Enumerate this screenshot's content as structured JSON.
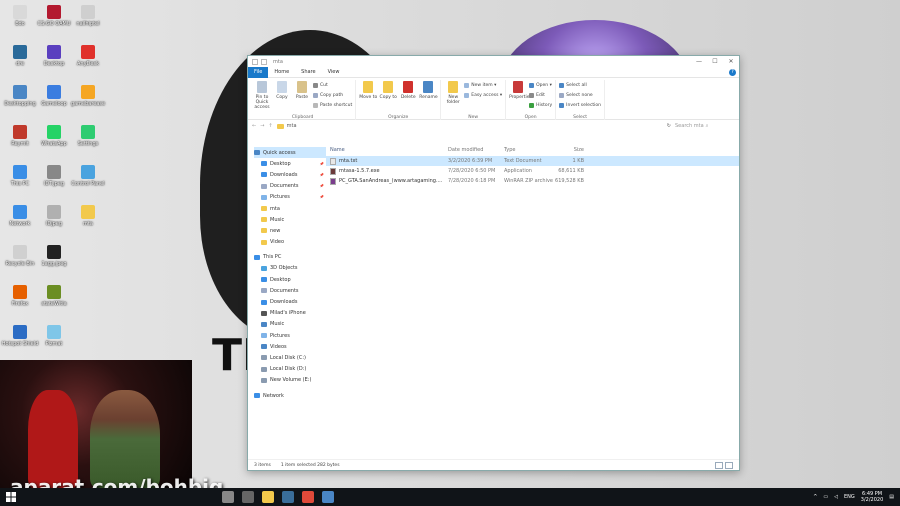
{
  "desktop": {
    "background_text": "TI",
    "icons": [
      {
        "label": "Edo",
        "color": "#d9d9d9",
        "col": 0,
        "row": 0
      },
      {
        "label": "CS:GO\nOAMU",
        "color": "#b3192f",
        "col": 1,
        "row": 0
      },
      {
        "label": "nailhiptel",
        "color": "#cfcfcf",
        "col": 2,
        "row": 0
      },
      {
        "label": "dre",
        "color": "#2a6a9a",
        "col": 0,
        "row": 1
      },
      {
        "label": "Desktop",
        "color": "#5a3fbf",
        "col": 1,
        "row": 1
      },
      {
        "label": "AnyDesk",
        "color": "#e0312b",
        "col": 2,
        "row": 1
      },
      {
        "label": "Desktopping",
        "color": "#4a86c5",
        "col": 0,
        "row": 2
      },
      {
        "label": "Gameloop",
        "color": "#3b7de0",
        "col": 1,
        "row": 2
      },
      {
        "label": "gamebarease",
        "color": "#f5a623",
        "col": 2,
        "row": 2
      },
      {
        "label": "Reymit",
        "color": "#c0392b",
        "col": 0,
        "row": 3
      },
      {
        "label": "WhatsApp",
        "color": "#25d366",
        "col": 1,
        "row": 3
      },
      {
        "label": "Settings",
        "color": "#2ecc71",
        "col": 2,
        "row": 3
      },
      {
        "label": "This PC",
        "color": "#3a8ee6",
        "col": 0,
        "row": 4
      },
      {
        "label": "IDT.jpeg",
        "color": "#888888",
        "col": 1,
        "row": 4
      },
      {
        "label": "Control Panel",
        "color": "#4aa3df",
        "col": 2,
        "row": 4
      },
      {
        "label": "Network",
        "color": "#3a8ee6",
        "col": 0,
        "row": 5
      },
      {
        "label": "IDjpeg",
        "color": "#b0b0b0",
        "col": 1,
        "row": 5
      },
      {
        "label": "mta",
        "color": "#f2c94c",
        "col": 2,
        "row": 5
      },
      {
        "label": "Recycle Bin",
        "color": "#d0d0d0",
        "col": 0,
        "row": 6
      },
      {
        "label": "1agg.jpeg",
        "color": "#222222",
        "col": 1,
        "row": 6
      },
      {
        "label": "Firefox",
        "color": "#e66000",
        "col": 0,
        "row": 7
      },
      {
        "label": "stateWitia",
        "color": "#6b8e23",
        "col": 1,
        "row": 7
      },
      {
        "label": "Hotspot Shield",
        "color": "#2b6cc4",
        "col": 0,
        "row": 8
      },
      {
        "label": "Pizmat",
        "color": "#7fc6e8",
        "col": 1,
        "row": 8
      }
    ]
  },
  "watermark": "aparat.com/bohbig",
  "explorer": {
    "title": "mta",
    "window_controls": {
      "minimize": "—",
      "maximize": "☐",
      "close": "✕"
    },
    "tabs": [
      {
        "label": "File",
        "active": true
      },
      {
        "label": "Home",
        "active": false
      },
      {
        "label": "Share",
        "active": false
      },
      {
        "label": "View",
        "active": false
      }
    ],
    "help": "?",
    "ribbon": {
      "clipboard": {
        "name": "Clipboard",
        "big": [
          {
            "label": "Pin to Quick access",
            "icon": "pin-icon",
            "color": "#b8c7d9"
          },
          {
            "label": "Copy",
            "icon": "copy-icon",
            "color": "#c9d7e8"
          },
          {
            "label": "Paste",
            "icon": "paste-icon",
            "color": "#d9c28a"
          }
        ],
        "small": [
          {
            "label": "Cut",
            "icon": "scissors-icon",
            "color": "#888888"
          },
          {
            "label": "Copy path",
            "icon": "copy-path-icon",
            "color": "#9aa8c4"
          },
          {
            "label": "Paste shortcut",
            "icon": "paste-shortcut-icon",
            "color": "#b8b8b8"
          }
        ]
      },
      "organize": {
        "name": "Organize",
        "big": [
          {
            "label": "Move to",
            "icon": "move-to-icon",
            "color": "#f2c94c"
          },
          {
            "label": "Copy to",
            "icon": "copy-to-icon",
            "color": "#f2c94c"
          },
          {
            "label": "Delete",
            "icon": "delete-icon",
            "color": "#d0312d"
          },
          {
            "label": "Rename",
            "icon": "rename-icon",
            "color": "#4a86c5"
          }
        ]
      },
      "new": {
        "name": "New",
        "big": [
          {
            "label": "New folder",
            "icon": "new-folder-icon",
            "color": "#f2c94c"
          }
        ],
        "small": [
          {
            "label": "New item ▾",
            "icon": "new-item-icon",
            "color": "#9ab8dd"
          },
          {
            "label": "Easy access ▾",
            "icon": "easy-access-icon",
            "color": "#9ab8dd"
          }
        ]
      },
      "open": {
        "name": "Open",
        "big": [
          {
            "label": "Properties",
            "icon": "properties-icon",
            "color": "#c83a3a"
          }
        ],
        "small": [
          {
            "label": "Open ▾",
            "icon": "open-icon",
            "color": "#4a86c5"
          },
          {
            "label": "Edit",
            "icon": "edit-icon",
            "color": "#8a8a8a"
          },
          {
            "label": "History",
            "icon": "history-icon",
            "color": "#3aa040"
          }
        ]
      },
      "select": {
        "name": "Select",
        "small": [
          {
            "label": "Select all",
            "icon": "select-all-icon",
            "color": "#4a86c5"
          },
          {
            "label": "Select none",
            "icon": "select-none-icon",
            "color": "#9aa8c4"
          },
          {
            "label": "Invert selection",
            "icon": "invert-selection-icon",
            "color": "#4a86c5"
          }
        ]
      }
    },
    "address": {
      "back": "←",
      "forward": "→",
      "up": "↑",
      "path": "mta",
      "refresh": "↻",
      "search_placeholder": "Search mta"
    },
    "nav": [
      {
        "label": "Quick access",
        "level": 1,
        "color": "#4a86c5",
        "selected": true,
        "pin": false
      },
      {
        "label": "Desktop",
        "level": 2,
        "color": "#3a8ee6",
        "pin": true
      },
      {
        "label": "Downloads",
        "level": 2,
        "color": "#3a8ee6",
        "pin": true
      },
      {
        "label": "Documents",
        "level": 2,
        "color": "#9aa8c4",
        "pin": true
      },
      {
        "label": "Pictures",
        "level": 2,
        "color": "#7fb3e8",
        "pin": true
      },
      {
        "label": "mta",
        "level": 2,
        "color": "#f2c94c",
        "pin": false
      },
      {
        "label": "Music",
        "level": 2,
        "color": "#f2c94c",
        "pin": false
      },
      {
        "label": "new",
        "level": 2,
        "color": "#f2c94c",
        "pin": false
      },
      {
        "label": "Video",
        "level": 2,
        "color": "#f2c94c",
        "pin": false
      },
      {
        "gap": true
      },
      {
        "label": "This PC",
        "level": 1,
        "color": "#3a8ee6",
        "pin": false
      },
      {
        "label": "3D Objects",
        "level": 2,
        "color": "#4aa3df",
        "pin": false
      },
      {
        "label": "Desktop",
        "level": 2,
        "color": "#3a8ee6",
        "pin": false
      },
      {
        "label": "Documents",
        "level": 2,
        "color": "#9aa8c4",
        "pin": false
      },
      {
        "label": "Downloads",
        "level": 2,
        "color": "#3a8ee6",
        "pin": false
      },
      {
        "label": "Milad's iPhone",
        "level": 2,
        "color": "#555555",
        "pin": false
      },
      {
        "label": "Music",
        "level": 2,
        "color": "#4a86c5",
        "pin": false
      },
      {
        "label": "Pictures",
        "level": 2,
        "color": "#7fb3e8",
        "pin": false
      },
      {
        "label": "Videos",
        "level": 2,
        "color": "#4a86c5",
        "pin": false
      },
      {
        "label": "Local Disk (C:)",
        "level": 2,
        "color": "#8a9bb0",
        "pin": false
      },
      {
        "label": "Local Disk (D:)",
        "level": 2,
        "color": "#8a9bb0",
        "pin": false
      },
      {
        "label": "New Volume (E:)",
        "level": 2,
        "color": "#8a9bb0",
        "pin": false
      },
      {
        "gap": true
      },
      {
        "label": "Network",
        "level": 1,
        "color": "#3a8ee6",
        "pin": false
      }
    ],
    "columns": {
      "name": "Name",
      "date": "Date modified",
      "type": "Type",
      "size": "Size"
    },
    "files": [
      {
        "name": "mta.txt",
        "date": "3/2/2020 6:39 PM",
        "type": "Text Document",
        "size": "1 KB",
        "icon": "text-file-icon",
        "color": "#e8e8e8",
        "selected": true
      },
      {
        "name": "mtasa-1.5.7.exe",
        "date": "7/28/2020 6:50 PM",
        "type": "Application",
        "size": "68,611 KB",
        "icon": "exe-file-icon",
        "color": "#6a3a3a",
        "selected": false
      },
      {
        "name": "PC_GTA.SanAndreas_(www.artagaming....",
        "date": "7/28/2020 6:18 PM",
        "type": "WinRAR ZIP archive",
        "size": "619,528 KB",
        "icon": "zip-file-icon",
        "color": "#7a3d8c",
        "selected": false
      }
    ],
    "status": {
      "count": "3 items",
      "selection": "1 item selected  282 bytes"
    }
  },
  "taskbar": {
    "apps": [
      {
        "name": "search-app",
        "color": "#888888"
      },
      {
        "name": "task-view",
        "color": "#666666"
      },
      {
        "name": "explorer-app",
        "color": "#f2c94c"
      },
      {
        "name": "steam-app",
        "color": "#3a6e9a"
      },
      {
        "name": "chrome-app",
        "color": "#e04a3a"
      },
      {
        "name": "photos-app",
        "color": "#4a86c5"
      }
    ],
    "tray": {
      "lang": "ENG",
      "time": "6:49 PM",
      "date": "3/2/2020"
    }
  }
}
